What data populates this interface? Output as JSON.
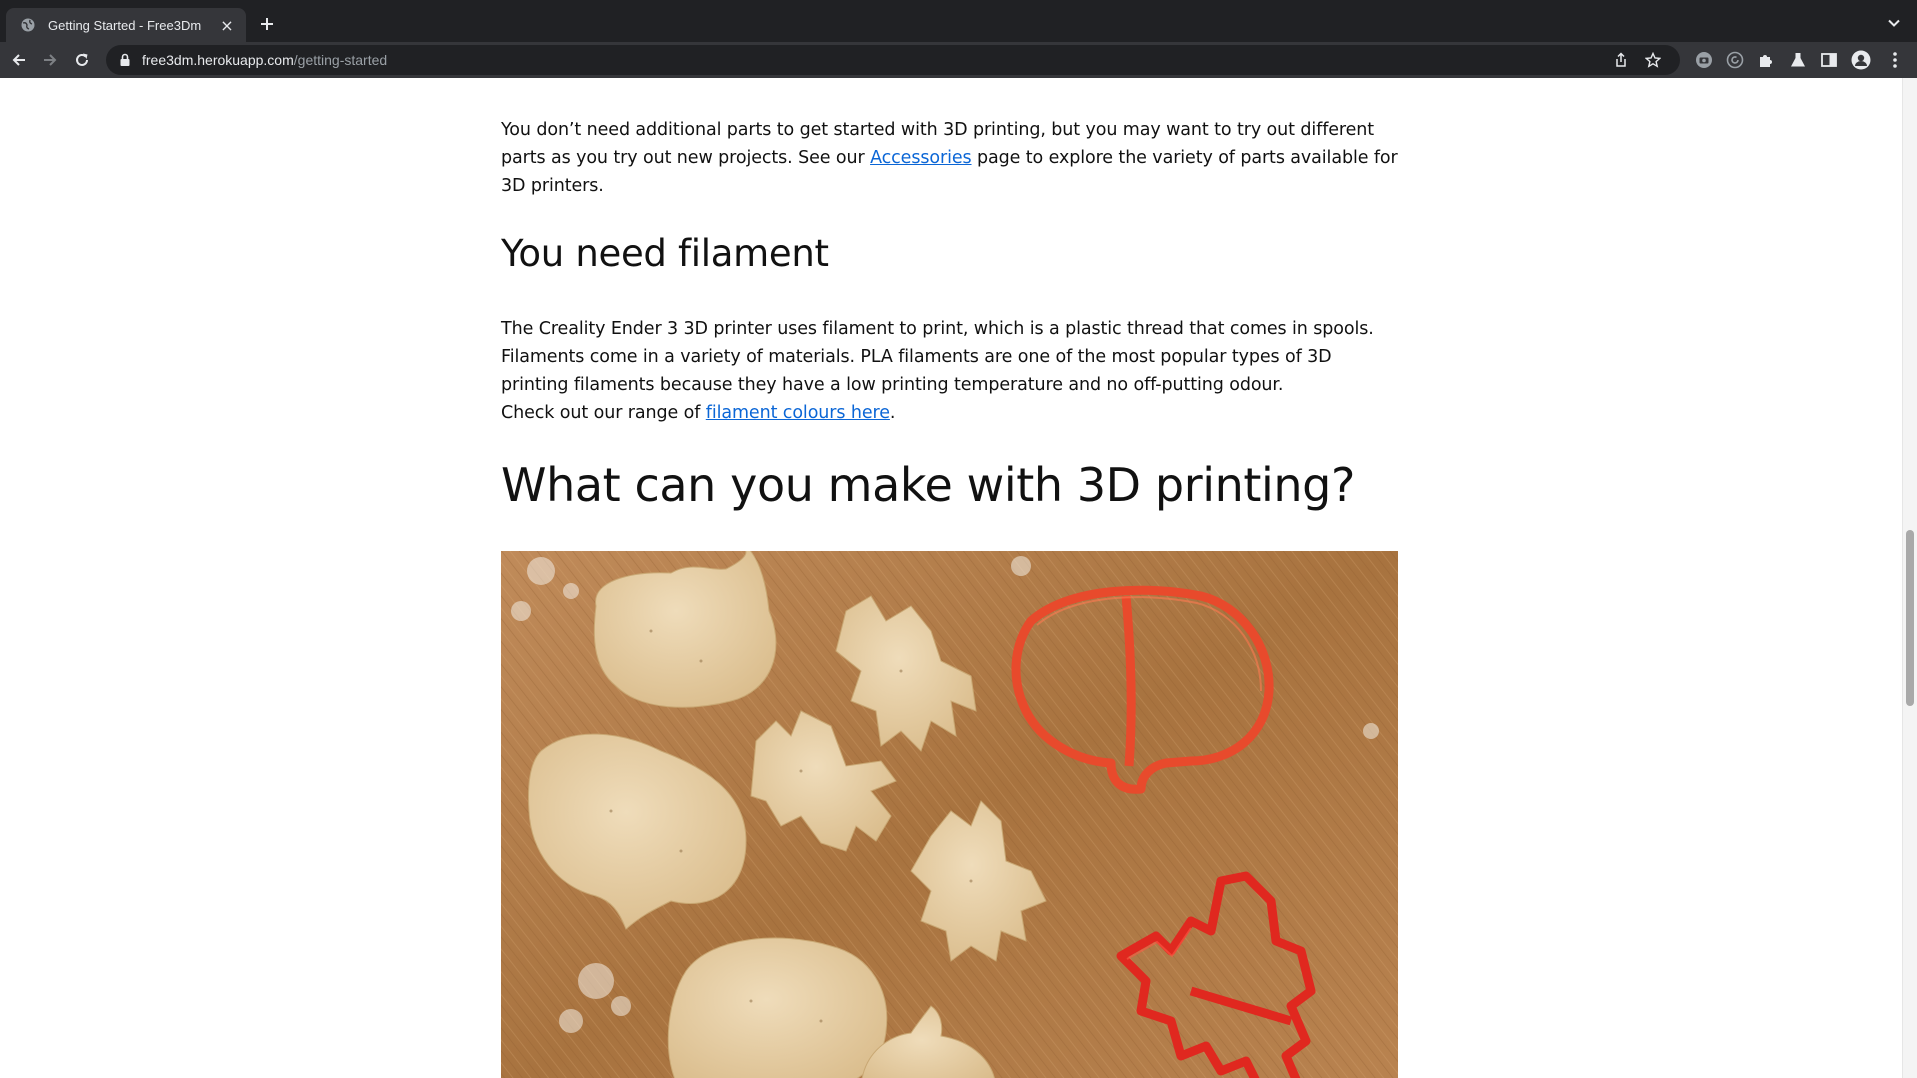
{
  "browser": {
    "tab_title": "Getting Started - Free3Dm",
    "tab_close": "×",
    "new_tab": "+",
    "url_host": "free3dm.herokuapp.com",
    "url_path": "/getting-started"
  },
  "article": {
    "parts_text_before": "You don’t need additional parts to get started with 3D printing, but you may want to try out different parts as you try out new projects. See our ",
    "parts_link": "Accessories",
    "parts_text_after": " page to explore the variety of parts available for 3D printers.",
    "filament_heading": "You need filament",
    "filament_para": "The Creality Ender 3 3D printer uses filament to print, which is a plastic thread that comes in spools. Filaments come in a variety of materials. PLA filaments are one of the most popular types of 3D printing filaments because they have a low printing temperature and no off-putting odour.",
    "check_text_before": "Check out our range of ",
    "check_link": "filament colours here",
    "check_text_after": ".",
    "make_heading": "What can you make with 3D printing?"
  },
  "colors": {
    "link": "#0b66d6",
    "chrome_dark": "#202124",
    "chrome_toolbar": "#35363a",
    "cutter_orange": "#e84a2c",
    "cutter_red": "#e0281f",
    "dough": "#e6cfa8",
    "wood": "#b07a4a"
  }
}
